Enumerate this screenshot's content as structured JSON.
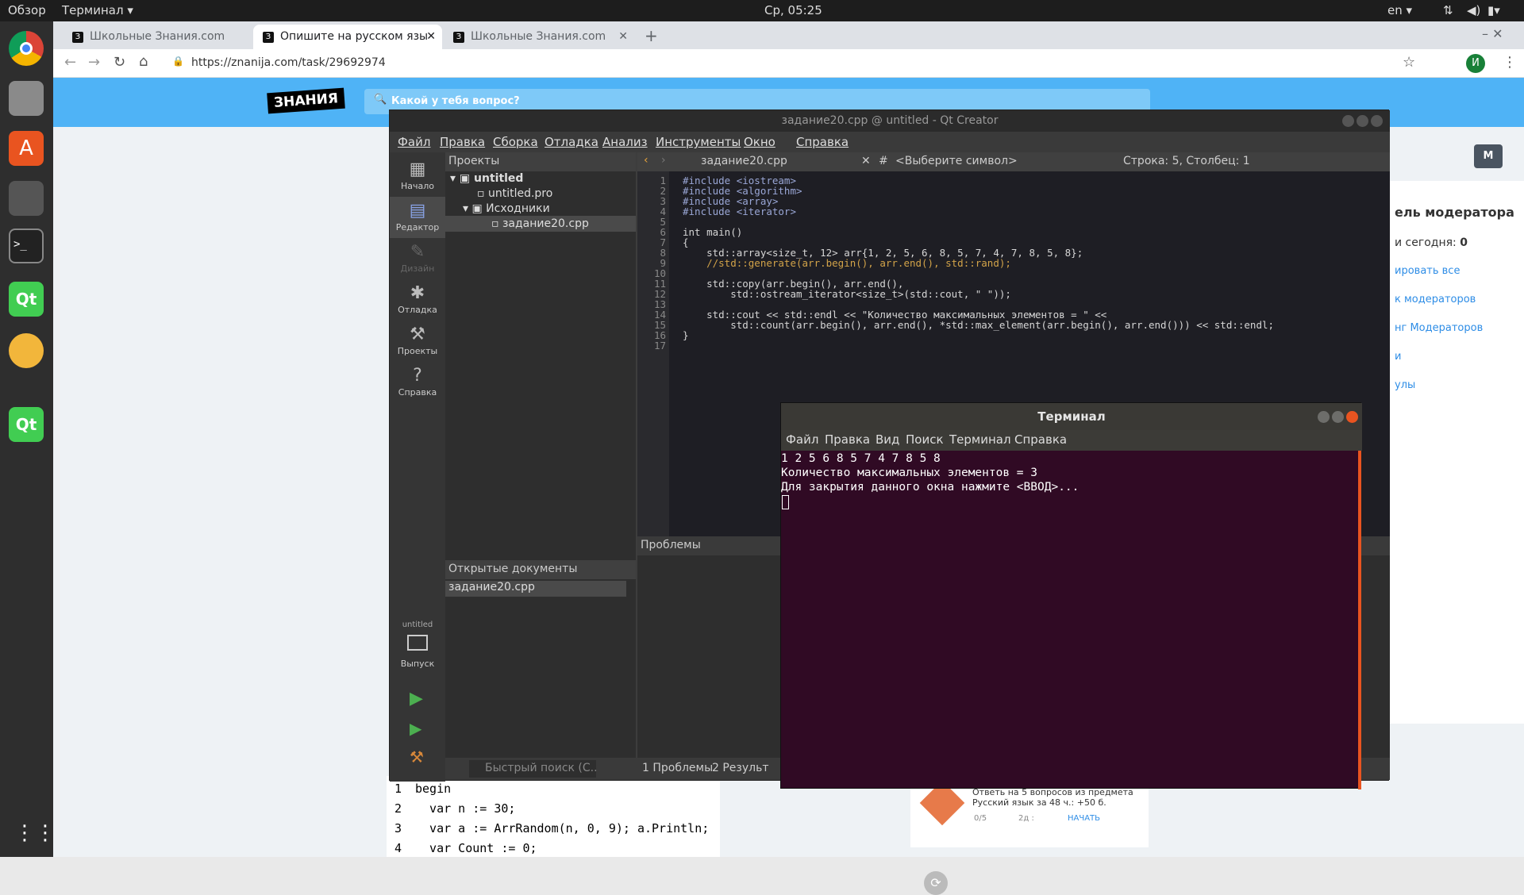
{
  "topbar": {
    "overview": "Обзор",
    "app": "Терминал ▾",
    "clock": "Ср, 05:25",
    "lang": "en ▾"
  },
  "browser": {
    "tabs": [
      {
        "label": "Школьные Знания.com",
        "active": false
      },
      {
        "label": "Опишите на русском язы",
        "active": true
      },
      {
        "label": "Школьные Знания.com",
        "active": false
      }
    ],
    "url": "https://znanija.com/task/29692974",
    "user_initial": "И"
  },
  "site": {
    "logo": "ЗНАНИЯ",
    "search_placeholder": "Какой у тебя вопрос?",
    "avatar": "M",
    "mod_title": "ель модератора",
    "mod_today": "и сегодня:",
    "mod_today_val": "0",
    "mod_links": [
      "ировать все",
      "к модераторов",
      "нг Модераторов",
      "и",
      "улы"
    ],
    "code": [
      "begin",
      "  var n := 30;",
      "  var a := ArrRandom(n, 0, 9); a.Println;",
      "  var Count := 0;"
    ],
    "promo": "Ответь на 5 вопросов из предмета Русский язык за 48 ч.: +50 б.",
    "promo_btn": "НАЧАТЬ",
    "promo_count": "0/5",
    "promo_time": "2д :"
  },
  "qt": {
    "title": "задание20.cpp @ untitled - Qt Creator",
    "menu": [
      "Файл",
      "Правка",
      "Сборка",
      "Отладка",
      "Анализ",
      "Инструменты",
      "Окно",
      "Справка"
    ],
    "modes": [
      {
        "label": "Начало",
        "icon": "▦"
      },
      {
        "label": "Редактор",
        "icon": "▤"
      },
      {
        "label": "Дизайн",
        "icon": "✎"
      },
      {
        "label": "Отладка",
        "icon": "✱"
      },
      {
        "label": "Проекты",
        "icon": "🔧"
      },
      {
        "label": "Справка",
        "icon": "?"
      }
    ],
    "run_target": "untitled",
    "run_mode": "Выпуск",
    "projects_label": "Проекты",
    "tree": {
      "root": "untitled",
      "pro": "untitled.pro",
      "sources": "Исходники",
      "file": "задание20.cpp"
    },
    "open_docs_label": "Открытые документы",
    "open_doc": "задание20.cpp",
    "editor_file": "задание20.cpp",
    "symbol_placeholder": "<Выберите символ>",
    "position": "Строка: 5, Столбец: 1",
    "code": [
      "#include <iostream>",
      "#include <algorithm>",
      "#include <array>",
      "#include <iterator>",
      "",
      "int main()",
      "{",
      "    std::array<size_t, 12> arr{1, 2, 5, 6, 8, 5, 7, 4, 7, 8, 5, 8};",
      "    //std::generate(arr.begin(), arr.end(), std::rand);",
      "",
      "    std::copy(arr.begin(), arr.end(),",
      "        std::ostream_iterator<size_t>(std::cout, \" \"));",
      "",
      "    std::cout << std::endl << \"Количество максимальных элементов = \" <<",
      "        std::count(arr.begin(), arr.end(), *std::max_element(arr.begin(), arr.end())) << std::endl;",
      "}",
      ""
    ],
    "line_numbers": [
      "1",
      "2",
      "3",
      "4",
      "5",
      "6",
      "7",
      "8",
      "9",
      "10",
      "11",
      "12",
      "13",
      "14",
      "15",
      "16",
      "17"
    ],
    "problems_label": "Проблемы",
    "search_placeholder": "Быстрый поиск (С...",
    "bottom_tabs": [
      "1  Проблемы",
      "2  Результ"
    ]
  },
  "terminal": {
    "title": "Терминал",
    "menu": [
      "Файл",
      "Правка",
      "Вид",
      "Поиск",
      "Терминал",
      "Справка"
    ],
    "lines": [
      "1 2 5 6 8 5 7 4 7 8 5 8",
      "Количество максимальных элементов = 3",
      "Для закрытия данного окна нажмите <ВВОД>..."
    ]
  }
}
